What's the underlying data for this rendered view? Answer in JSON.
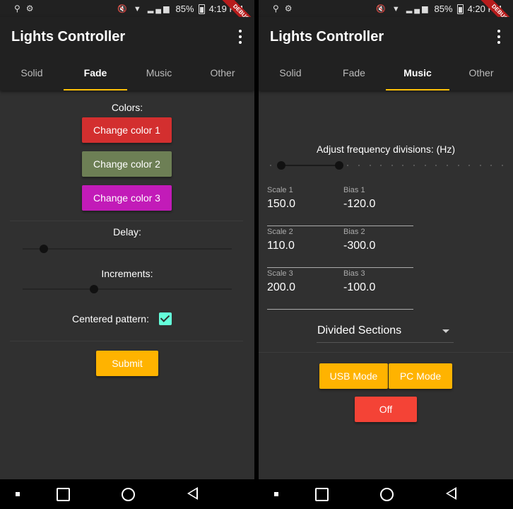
{
  "app_title": "Lights Controller",
  "tabs": [
    "Solid",
    "Fade",
    "Music",
    "Other"
  ],
  "colors": {
    "accent": "#ffc107",
    "color1": "#d32f2f",
    "color2": "#6d7f55",
    "color3": "#c21bb8",
    "off": "#f44336",
    "checkbox": "#64ffda"
  },
  "left": {
    "status": {
      "battery": "85%",
      "time": "4:19 PM",
      "debug": "DEBUG"
    },
    "active_tab": "Fade",
    "fade": {
      "colors_label": "Colors:",
      "buttons": [
        "Change color 1",
        "Change color 2",
        "Change color 3"
      ],
      "delay_label": "Delay:",
      "delay_value": 0.1,
      "increments_label": "Increments:",
      "increments_value": 0.34,
      "centered_label": "Centered pattern:",
      "centered_checked": true,
      "submit_label": "Submit"
    }
  },
  "right": {
    "status": {
      "battery": "85%",
      "time": "4:20 PM",
      "debug": "DEBUG"
    },
    "active_tab": "Music",
    "music": {
      "freq_label": "Adjust frequency divisions: (Hz)",
      "range_start": 0.05,
      "range_end": 0.3,
      "fields": [
        {
          "label": "Scale 1",
          "value": "150.0"
        },
        {
          "label": "Bias 1",
          "value": "-120.0"
        },
        {
          "label": "Scale 2",
          "value": "110.0"
        },
        {
          "label": "Bias 2",
          "value": "-300.0"
        },
        {
          "label": "Scale 3",
          "value": "200.0"
        },
        {
          "label": "Bias 3",
          "value": "-100.0"
        }
      ],
      "dropdown_value": "Divided Sections",
      "usb_label": "USB Mode",
      "pc_label": "PC Mode",
      "off_label": "Off"
    }
  }
}
